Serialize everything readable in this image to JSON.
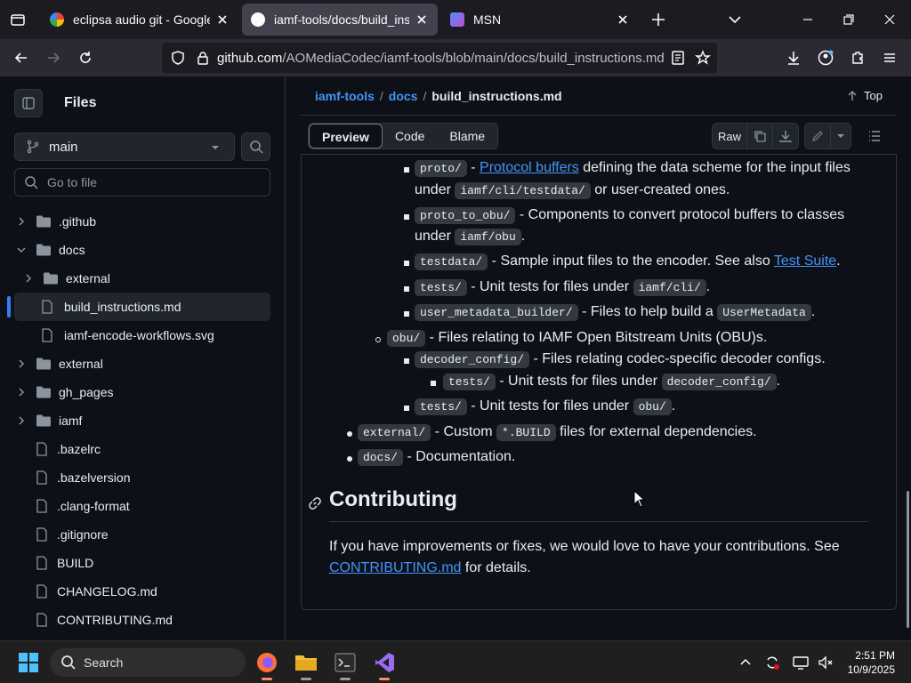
{
  "browser": {
    "tabs": [
      {
        "title": "eclipsa audio git - Google Searc",
        "favicon": "google-icon"
      },
      {
        "title": "iamf-tools/docs/build_instructio",
        "favicon": "github-icon",
        "active": true
      },
      {
        "title": "MSN",
        "favicon": "msn-icon"
      }
    ],
    "url_host": "github.com",
    "url_path": "/AOMediaCodec/iamf-tools/blob/main/docs/build_instructions.md"
  },
  "sidebar": {
    "title": "Files",
    "branch": "main",
    "goto_placeholder": "Go to file",
    "tree": [
      {
        "label": ".github",
        "kind": "folder",
        "depth": 0,
        "expanded": false
      },
      {
        "label": "docs",
        "kind": "folder",
        "depth": 0,
        "expanded": true
      },
      {
        "label": "external",
        "kind": "folder",
        "depth": 1,
        "expanded": false
      },
      {
        "label": "build_instructions.md",
        "kind": "file",
        "depth": 1,
        "selected": true
      },
      {
        "label": "iamf-encode-workflows.svg",
        "kind": "file",
        "depth": 1
      },
      {
        "label": "external",
        "kind": "folder",
        "depth": 0,
        "expanded": false
      },
      {
        "label": "gh_pages",
        "kind": "folder",
        "depth": 0,
        "expanded": false
      },
      {
        "label": "iamf",
        "kind": "folder",
        "depth": 0,
        "expanded": false
      },
      {
        "label": ".bazelrc",
        "kind": "file",
        "depth": 0
      },
      {
        "label": ".bazelversion",
        "kind": "file",
        "depth": 0
      },
      {
        "label": ".clang-format",
        "kind": "file",
        "depth": 0
      },
      {
        "label": ".gitignore",
        "kind": "file",
        "depth": 0
      },
      {
        "label": "BUILD",
        "kind": "file",
        "depth": 0
      },
      {
        "label": "CHANGELOG.md",
        "kind": "file",
        "depth": 0
      },
      {
        "label": "CONTRIBUTING.md",
        "kind": "file",
        "depth": 0
      }
    ]
  },
  "breadcrumb": {
    "repo": "iamf-tools",
    "dir": "docs",
    "file": "build_instructions.md",
    "top": "Top"
  },
  "toolbar": {
    "preview": "Preview",
    "code": "Code",
    "blame": "Blame",
    "raw": "Raw"
  },
  "content": {
    "proto_code": "proto/",
    "proto_link": "Protocol buffers",
    "proto_text": "defining the data scheme for the input files",
    "proto_under": "under",
    "proto_code2": "iamf/cli/testdata/",
    "proto_tail": "or user-created ones.",
    "p2o_code": "proto_to_obu/",
    "p2o_text": "- Components to convert protocol buffers to classes",
    "p2o_under": "under",
    "p2o_code2": "iamf/obu",
    "testdata_code": "testdata/",
    "testdata_text": "- Sample input files to the encoder. See also",
    "testdata_link": "Test Suite",
    "tests1_code": "tests/",
    "tests1_text": "- Unit tests for files under",
    "tests1_code2": "iamf/cli/",
    "umb_code": "user_metadata_builder/",
    "umb_text": "- Files to help build a",
    "umb_code2": "UserMetadata",
    "obu_code": "obu/",
    "obu_text": "- Files relating to IAMF Open Bitstream Units (OBU)s.",
    "dc_code": "decoder_config/",
    "dc_text": "- Files relating codec-specific decoder configs.",
    "dct_code": "tests/",
    "dct_text": "- Unit tests for files under",
    "dct_code2": "decoder_config/",
    "obut_code": "tests/",
    "obut_text": "- Unit tests for files under",
    "obut_code2": "obu/",
    "ext_code": "external/",
    "ext_text": "- Custom",
    "ext_code2": "*.BUILD",
    "ext_tail": "files for external dependencies.",
    "docs_code": "docs/",
    "docs_text": "- Documentation.",
    "heading": "Contributing",
    "para_text": "If you have improvements or fixes, we would love to have your contributions. See",
    "para_link": "CONTRIBUTING.md",
    "para_tail": "for details."
  },
  "taskbar": {
    "search": "Search",
    "time": "2:51 PM",
    "date": "10/9/2025"
  },
  "colors": {
    "accent": "#2f81f7",
    "link": "#4493f8",
    "bg": "#0d1117"
  }
}
